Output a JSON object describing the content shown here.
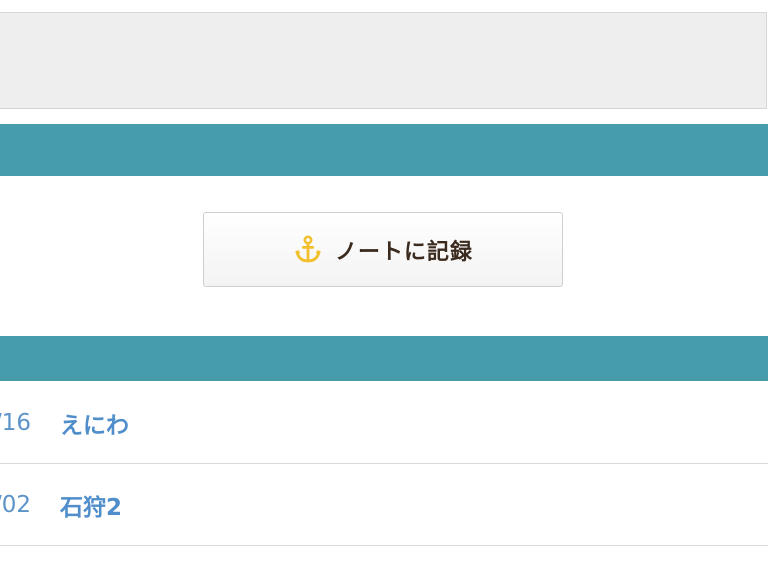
{
  "record_button": {
    "label": "ノートに記録",
    "icon": "anchor-icon",
    "icon_color": "#f2c02e"
  },
  "list": [
    {
      "date": "/16",
      "title": "えにわ"
    },
    {
      "date": "/02",
      "title": "石狩2"
    }
  ],
  "colors": {
    "accent_band": "#469cab",
    "link": "#4f8dcb"
  }
}
